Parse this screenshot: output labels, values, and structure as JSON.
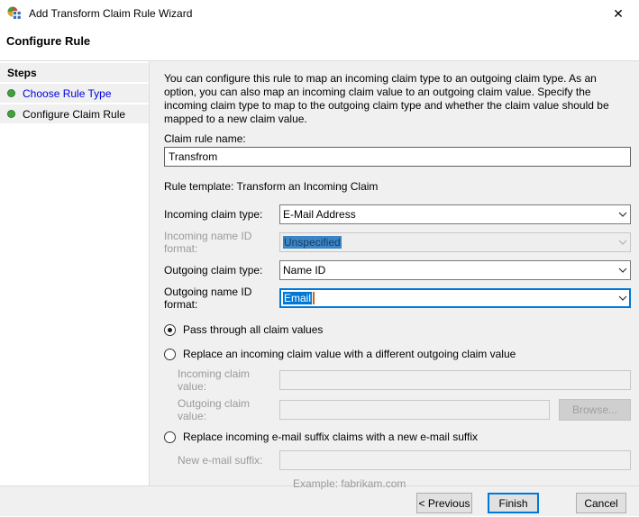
{
  "window": {
    "title": "Add Transform Claim Rule Wizard"
  },
  "icons": {
    "close": "✕"
  },
  "header": {
    "title": "Configure Rule"
  },
  "steps": {
    "title": "Steps",
    "items": [
      {
        "label": "Choose Rule Type"
      },
      {
        "label": "Configure Claim Rule"
      }
    ]
  },
  "main": {
    "description": "You can configure this rule to map an incoming claim type to an outgoing claim type. As an option, you can also map an incoming claim value to an outgoing claim value. Specify the incoming claim type to map to the outgoing claim type and whether the claim value should be mapped to a new claim value.",
    "claim_rule_name": {
      "label": "Claim rule name:",
      "value": "Transfrom"
    },
    "rule_template": "Rule template: Transform an Incoming Claim",
    "combos": {
      "incoming_claim_type": {
        "label": "Incoming claim type:",
        "value": "E-Mail Address"
      },
      "incoming_name_id_format": {
        "label": "Incoming name ID format:",
        "value": "Unspecified"
      },
      "outgoing_claim_type": {
        "label": "Outgoing claim type:",
        "value": "Name ID"
      },
      "outgoing_name_id_format": {
        "label": "Outgoing name ID format:",
        "value": "Email"
      }
    },
    "options": {
      "pass_through": {
        "label": "Pass through all claim values",
        "selected": true
      },
      "replace_value": {
        "label": "Replace an incoming claim value with a different outgoing claim value",
        "selected": false
      },
      "replace_suffix": {
        "label": "Replace incoming e-mail suffix claims with a new e-mail suffix",
        "selected": false
      }
    },
    "fields": {
      "incoming_claim_value": {
        "label": "Incoming claim value:",
        "value": ""
      },
      "outgoing_claim_value": {
        "label": "Outgoing claim value:",
        "value": ""
      },
      "new_email_suffix": {
        "label": "New e-mail suffix:",
        "value": ""
      }
    },
    "browse_button": "Browse...",
    "example_text": "Example: fabrikam.com"
  },
  "footer": {
    "previous": "< Previous",
    "finish": "Finish",
    "cancel": "Cancel"
  },
  "colors": {
    "accent": "#0078d7",
    "step_bullet": "#3fa13f",
    "link": "#0000e0"
  }
}
